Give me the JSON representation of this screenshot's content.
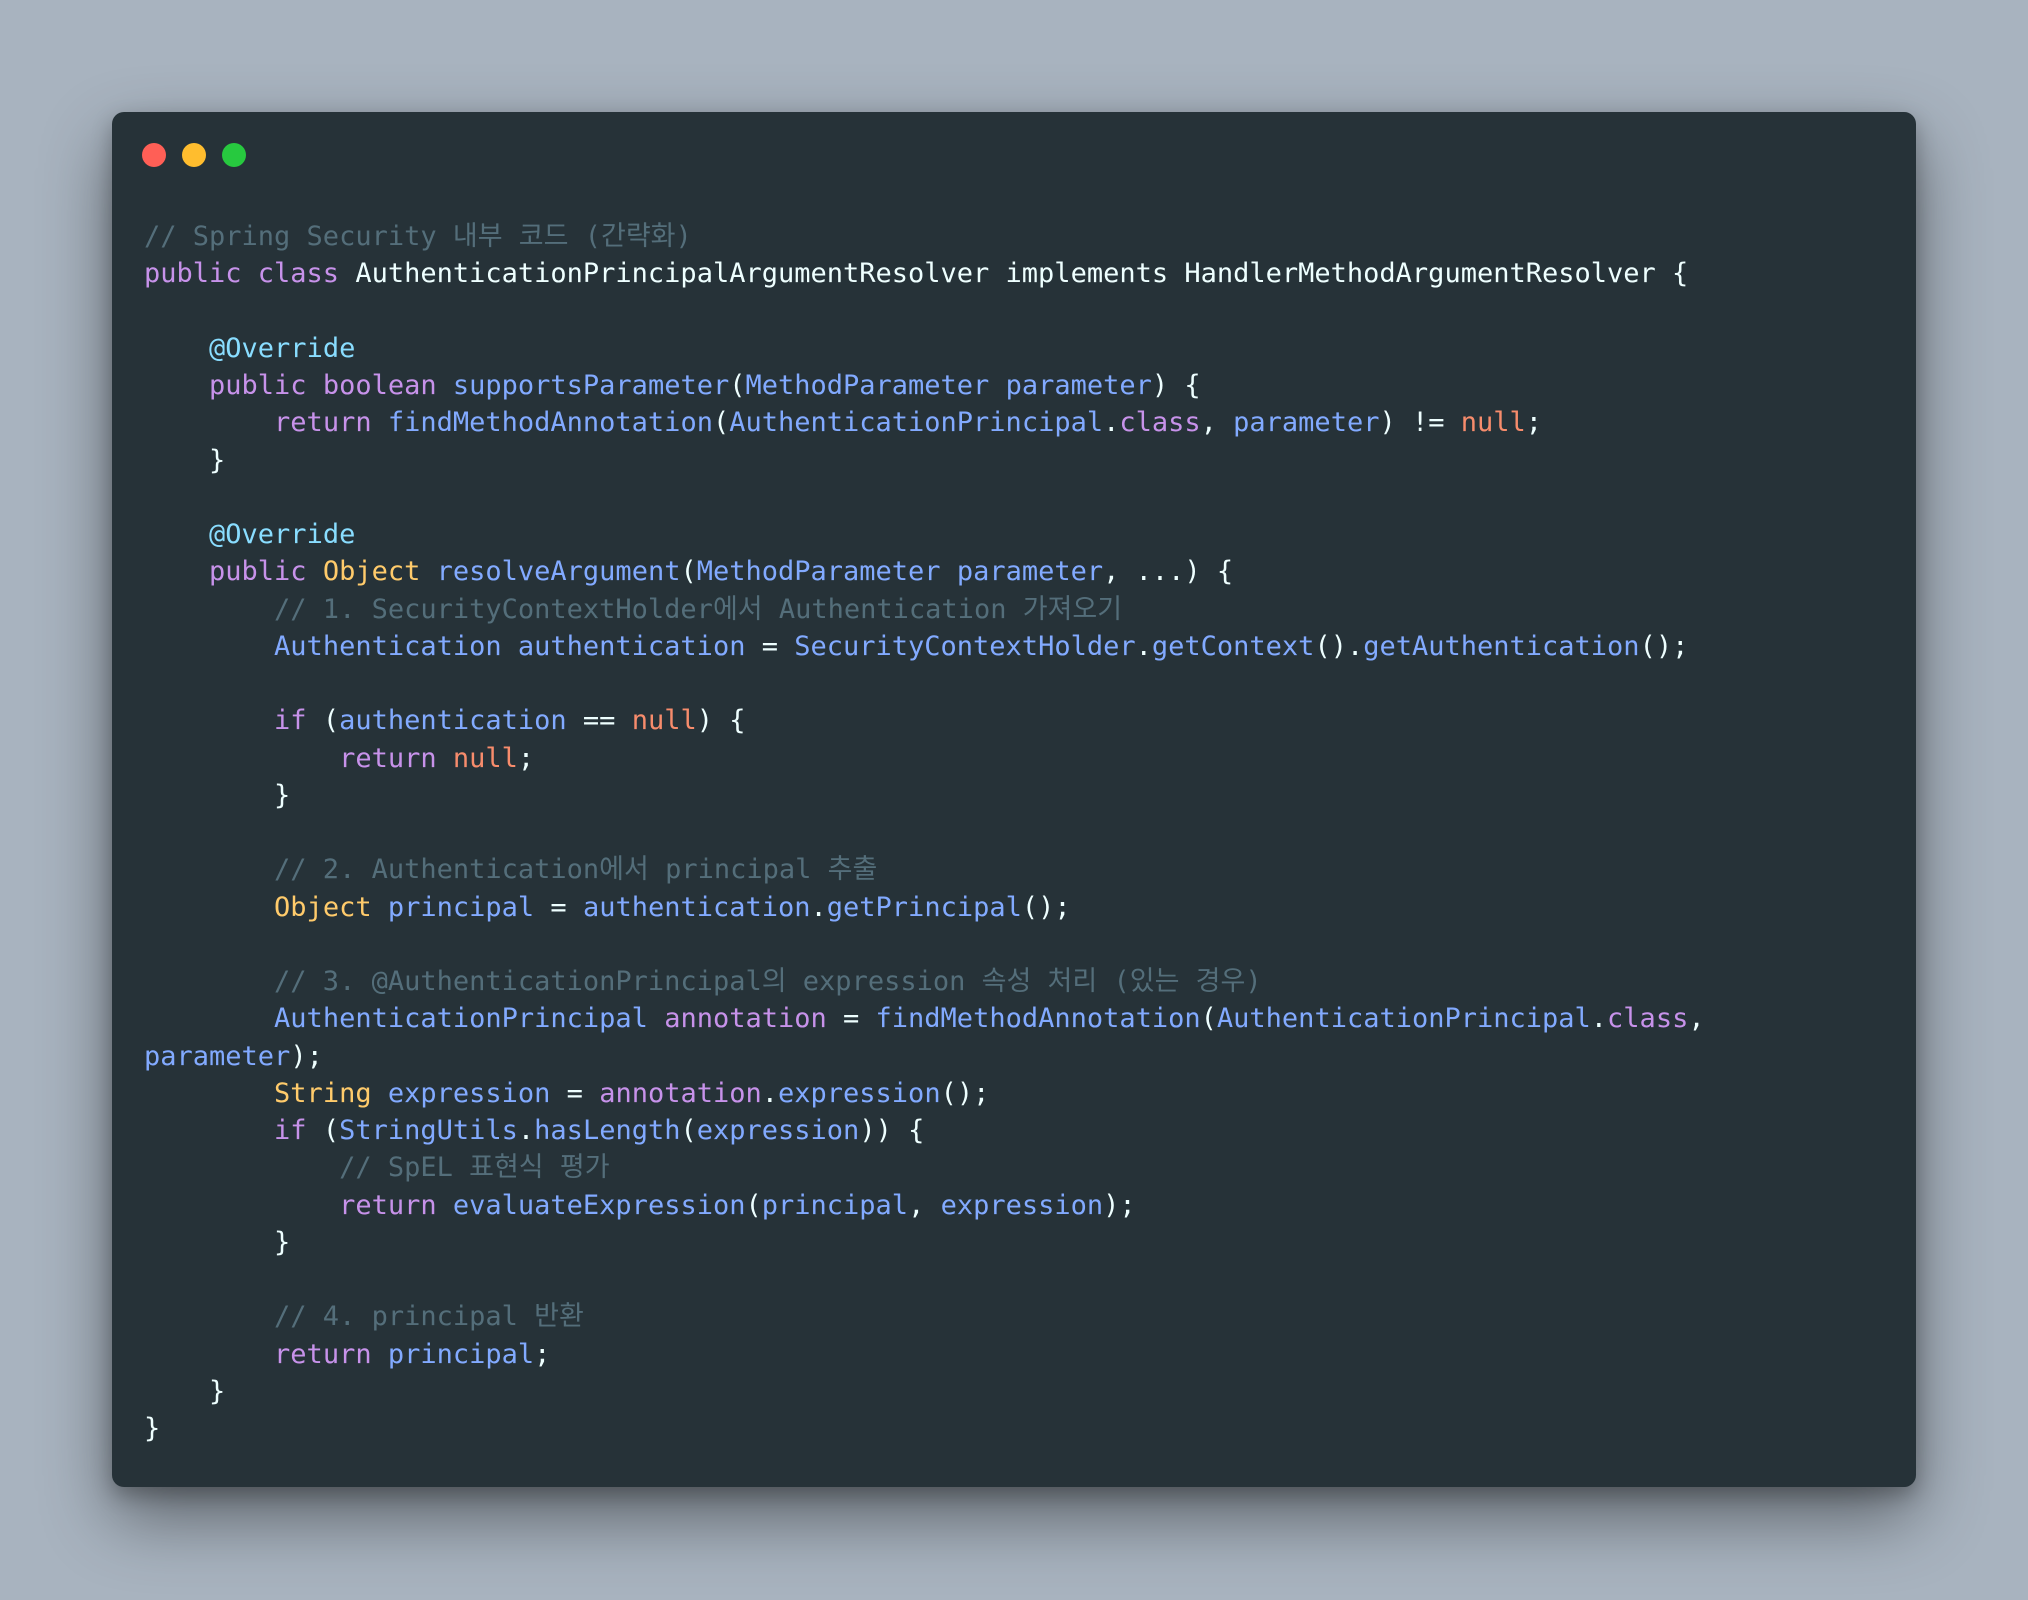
{
  "window": {
    "buttons": [
      "close",
      "minimize",
      "maximize"
    ]
  },
  "code": {
    "language": "java",
    "lines": [
      [
        {
          "t": "// Spring Security 내부 코드 (간략화)",
          "c": "comment"
        }
      ],
      [
        {
          "t": "public class ",
          "c": "keyword"
        },
        {
          "t": "AuthenticationPrincipalArgumentResolver implements HandlerMethodArgumentResolver {",
          "c": "plain"
        }
      ],
      [],
      [
        {
          "t": "    ",
          "c": "plain"
        },
        {
          "t": "@Override",
          "c": "annot"
        }
      ],
      [
        {
          "t": "    ",
          "c": "plain"
        },
        {
          "t": "public boolean ",
          "c": "keyword"
        },
        {
          "t": "supportsParameter",
          "c": "func"
        },
        {
          "t": "(",
          "c": "punct"
        },
        {
          "t": "MethodParameter parameter",
          "c": "param"
        },
        {
          "t": ") {",
          "c": "punct"
        }
      ],
      [
        {
          "t": "        ",
          "c": "plain"
        },
        {
          "t": "return ",
          "c": "keyword"
        },
        {
          "t": "findMethodAnnotation",
          "c": "func"
        },
        {
          "t": "(",
          "c": "punct"
        },
        {
          "t": "AuthenticationPrincipal",
          "c": "class"
        },
        {
          "t": ".",
          "c": "punct"
        },
        {
          "t": "class",
          "c": "keyword"
        },
        {
          "t": ", ",
          "c": "punct"
        },
        {
          "t": "parameter",
          "c": "param"
        },
        {
          "t": ") != ",
          "c": "punct"
        },
        {
          "t": "null",
          "c": "null"
        },
        {
          "t": ";",
          "c": "punct"
        }
      ],
      [
        {
          "t": "    }",
          "c": "punct"
        }
      ],
      [],
      [
        {
          "t": "    ",
          "c": "plain"
        },
        {
          "t": "@Override",
          "c": "annot"
        }
      ],
      [
        {
          "t": "    ",
          "c": "plain"
        },
        {
          "t": "public ",
          "c": "keyword"
        },
        {
          "t": "Object ",
          "c": "type"
        },
        {
          "t": "resolveArgument",
          "c": "func"
        },
        {
          "t": "(",
          "c": "punct"
        },
        {
          "t": "MethodParameter parameter",
          "c": "param"
        },
        {
          "t": ", ...) {",
          "c": "punct"
        }
      ],
      [
        {
          "t": "        // 1. SecurityContextHolder에서 Authentication 가져오기",
          "c": "comment"
        }
      ],
      [
        {
          "t": "        ",
          "c": "plain"
        },
        {
          "t": "Authentication authentication",
          "c": "class"
        },
        {
          "t": " = ",
          "c": "punct"
        },
        {
          "t": "SecurityContextHolder",
          "c": "class"
        },
        {
          "t": ".",
          "c": "punct"
        },
        {
          "t": "getContext",
          "c": "func"
        },
        {
          "t": "().",
          "c": "punct"
        },
        {
          "t": "getAuthentication",
          "c": "func"
        },
        {
          "t": "();",
          "c": "punct"
        }
      ],
      [],
      [
        {
          "t": "        ",
          "c": "plain"
        },
        {
          "t": "if ",
          "c": "keyword"
        },
        {
          "t": "(",
          "c": "punct"
        },
        {
          "t": "authentication",
          "c": "param"
        },
        {
          "t": " == ",
          "c": "punct"
        },
        {
          "t": "null",
          "c": "null"
        },
        {
          "t": ") {",
          "c": "punct"
        }
      ],
      [
        {
          "t": "            ",
          "c": "plain"
        },
        {
          "t": "return ",
          "c": "keyword"
        },
        {
          "t": "null",
          "c": "null"
        },
        {
          "t": ";",
          "c": "punct"
        }
      ],
      [
        {
          "t": "        }",
          "c": "punct"
        }
      ],
      [],
      [
        {
          "t": "        // 2. Authentication에서 principal 추출",
          "c": "comment"
        }
      ],
      [
        {
          "t": "        ",
          "c": "plain"
        },
        {
          "t": "Object ",
          "c": "type"
        },
        {
          "t": "principal",
          "c": "param"
        },
        {
          "t": " = ",
          "c": "punct"
        },
        {
          "t": "authentication",
          "c": "param"
        },
        {
          "t": ".",
          "c": "punct"
        },
        {
          "t": "getPrincipal",
          "c": "func"
        },
        {
          "t": "();",
          "c": "punct"
        }
      ],
      [],
      [
        {
          "t": "        // 3. @AuthenticationPrincipal의 expression 속성 처리 (있는 경우)",
          "c": "comment"
        }
      ],
      [
        {
          "t": "        ",
          "c": "plain"
        },
        {
          "t": "AuthenticationPrincipal ",
          "c": "class"
        },
        {
          "t": "annotation",
          "c": "var"
        },
        {
          "t": " = ",
          "c": "punct"
        },
        {
          "t": "findMethodAnnotation",
          "c": "func"
        },
        {
          "t": "(",
          "c": "punct"
        },
        {
          "t": "AuthenticationPrincipal",
          "c": "class"
        },
        {
          "t": ".",
          "c": "punct"
        },
        {
          "t": "class",
          "c": "keyword"
        },
        {
          "t": ",",
          "c": "punct"
        }
      ],
      [
        {
          "t": "parameter",
          "c": "param"
        },
        {
          "t": ");",
          "c": "punct"
        }
      ],
      [
        {
          "t": "        ",
          "c": "plain"
        },
        {
          "t": "String ",
          "c": "type"
        },
        {
          "t": "expression",
          "c": "param"
        },
        {
          "t": " = ",
          "c": "punct"
        },
        {
          "t": "annotation",
          "c": "var"
        },
        {
          "t": ".",
          "c": "punct"
        },
        {
          "t": "expression",
          "c": "func"
        },
        {
          "t": "();",
          "c": "punct"
        }
      ],
      [
        {
          "t": "        ",
          "c": "plain"
        },
        {
          "t": "if ",
          "c": "keyword"
        },
        {
          "t": "(",
          "c": "punct"
        },
        {
          "t": "StringUtils",
          "c": "class"
        },
        {
          "t": ".",
          "c": "punct"
        },
        {
          "t": "hasLength",
          "c": "func"
        },
        {
          "t": "(",
          "c": "punct"
        },
        {
          "t": "expression",
          "c": "param"
        },
        {
          "t": ")) {",
          "c": "punct"
        }
      ],
      [
        {
          "t": "            // SpEL 표현식 평가",
          "c": "comment"
        }
      ],
      [
        {
          "t": "            ",
          "c": "plain"
        },
        {
          "t": "return ",
          "c": "keyword"
        },
        {
          "t": "evaluateExpression",
          "c": "func"
        },
        {
          "t": "(",
          "c": "punct"
        },
        {
          "t": "principal",
          "c": "param"
        },
        {
          "t": ", ",
          "c": "punct"
        },
        {
          "t": "expression",
          "c": "param"
        },
        {
          "t": ");",
          "c": "punct"
        }
      ],
      [
        {
          "t": "        }",
          "c": "punct"
        }
      ],
      [],
      [
        {
          "t": "        // 4. principal 반환",
          "c": "comment"
        }
      ],
      [
        {
          "t": "        ",
          "c": "plain"
        },
        {
          "t": "return ",
          "c": "keyword"
        },
        {
          "t": "principal",
          "c": "param"
        },
        {
          "t": ";",
          "c": "punct"
        }
      ],
      [
        {
          "t": "    }",
          "c": "punct"
        }
      ],
      [
        {
          "t": "}",
          "c": "punct"
        }
      ]
    ]
  },
  "colors": {
    "background": "#a8b3bf",
    "window": "#263238",
    "comment": "#546e7a",
    "keyword": "#c792ea",
    "type": "#ffcb6b",
    "function": "#82aaff",
    "annotation": "#89ddff",
    "null": "#f78c6c",
    "text": "#eeffff"
  }
}
